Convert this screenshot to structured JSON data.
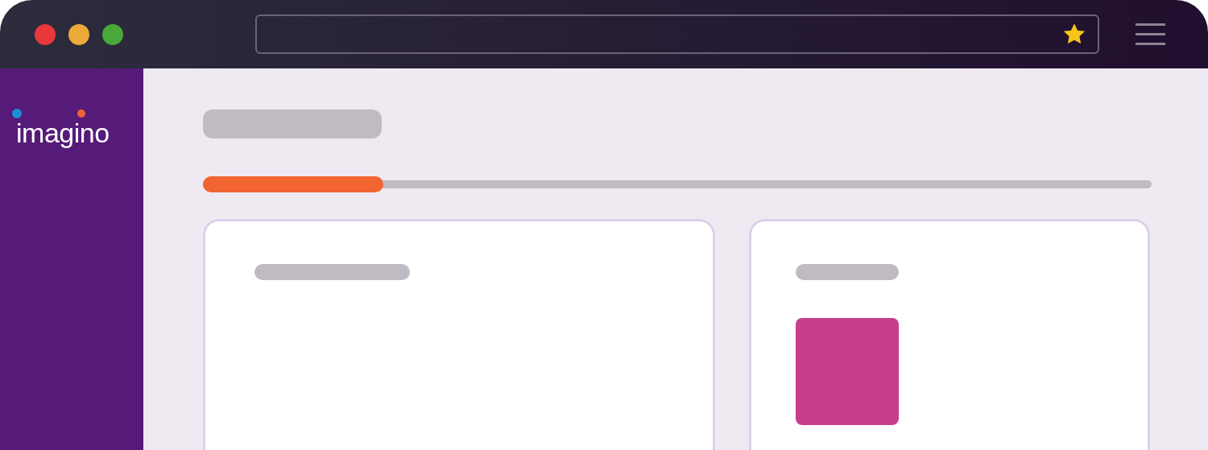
{
  "browser": {
    "bookmarked": true
  },
  "sidebar": {
    "logo": "imagino"
  },
  "progress": {
    "level": 0.19
  }
}
